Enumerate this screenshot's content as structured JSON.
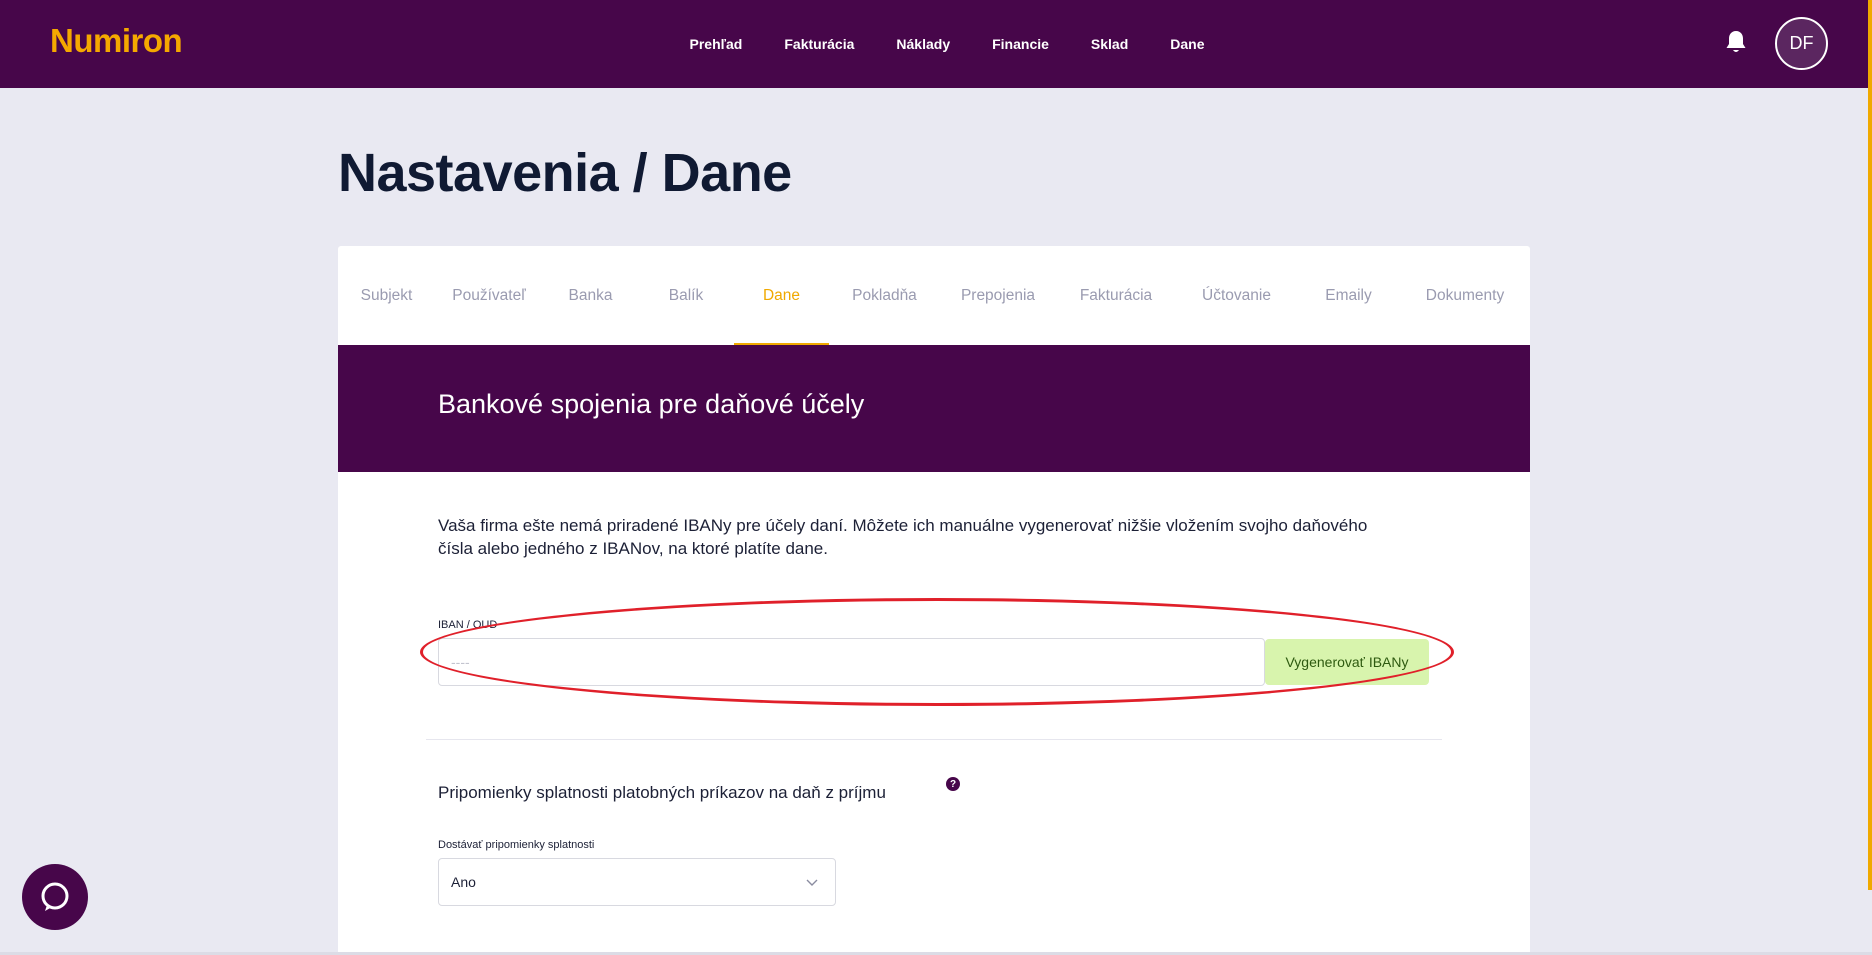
{
  "header": {
    "logo": "Numiron",
    "nav": [
      "Prehľad",
      "Fakturácia",
      "Náklady",
      "Financie",
      "Sklad",
      "Dane"
    ],
    "avatar_initials": "DF"
  },
  "page": {
    "title": "Nastavenia / Dane"
  },
  "tabs": [
    {
      "label": "Subjekt"
    },
    {
      "label": "Používateľ"
    },
    {
      "label": "Banka"
    },
    {
      "label": "Balík"
    },
    {
      "label": "Dane"
    },
    {
      "label": "Pokladňa"
    },
    {
      "label": "Prepojenia"
    },
    {
      "label": "Fakturácia"
    },
    {
      "label": "Účtovanie"
    },
    {
      "label": "Emaily"
    },
    {
      "label": "Dokumenty"
    }
  ],
  "active_tab": "Dane",
  "bank_section": {
    "title": "Bankové spojenia pre daňové účely",
    "info": "Vaša firma ešte nemá priradené IBANy pre účely daní. Môžete ich manuálne vygenerovať nižšie vložením svojho daňového čísla alebo jedného z IBANov, na ktoré platíte dane.",
    "field_label": "IBAN / OUD",
    "field_placeholder": "----",
    "field_value": "",
    "button_label": "Vygenerovať IBANy"
  },
  "reminders": {
    "title": "Pripomienky splatnosti platobných príkazov na daň z príjmu",
    "help_symbol": "?",
    "select_label": "Dostávať pripomienky splatnosti",
    "select_value": "Ano"
  },
  "colors": {
    "brand_purple": "#47064a",
    "accent_orange": "#f0a900",
    "button_green": "#d8f4ad",
    "highlight_red": "#e0202a"
  }
}
